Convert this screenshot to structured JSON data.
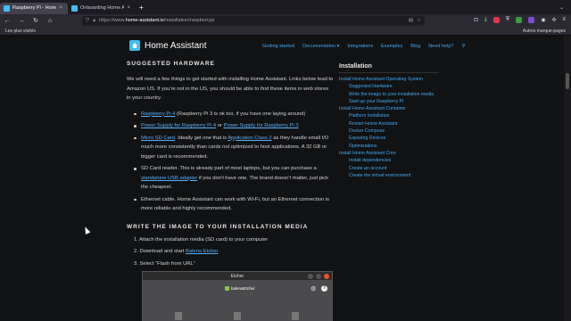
{
  "browser": {
    "tabs": [
      {
        "title": "Raspberry Pi - Home Assistant",
        "active": true
      },
      {
        "title": "Onboarding Home Assistant",
        "active": false
      }
    ],
    "url_prefix": "https://www.",
    "url_domain": "home-assistant.io",
    "url_path": "/installation/raspberrypi",
    "bookmarks": {
      "left": "Les plus visités",
      "right": "Autres marque-pages"
    }
  },
  "site": {
    "brand": "Home Assistant",
    "nav": [
      "Getting started",
      "Documentation ▾",
      "Integrations",
      "Examples",
      "Blog",
      "Need help?"
    ]
  },
  "main": {
    "hardware_heading": "SUGGESTED HARDWARE",
    "intro": "We will need a few things to get started with installing Home Assistant. Links below lead to Amazon US. If you’re not in the US, you should be able to find these items in web stores in your country.",
    "items": {
      "pi4_link": "Raspberry Pi 4",
      "pi4_rest": " (Raspberry Pi 3 is ok too, if you have one laying around)",
      "psu_link1": "Power Supply for Raspberry Pi 4",
      "psu_or": " or ",
      "psu_link2": "Power Supply for Raspberry Pi 3",
      "sd_link": "Micro SD Card",
      "sd_mid": ". Ideally get one that is ",
      "sd_link2": "Application Class 2",
      "sd_rest": " as they handle small I/O much more consistently than cards not optimized to host applications. A 32 GB or bigger card is recommended.",
      "reader_pre": "SD Card reader. This is already part of most laptops, but you can purchase a ",
      "reader_link": "standalone USB adapter",
      "reader_rest": " if you don’t have one. The brand doesn’t matter, just pick the cheapest.",
      "ethernet": "Ethernet cable. Home Assistant can work with Wi-Fi, but an Ethernet connection is more reliable and highly recommended."
    },
    "write_heading": "WRITE THE IMAGE TO YOUR INSTALLATION MEDIA",
    "steps": {
      "s1": "1. Attach the installation media (SD card) to your computer",
      "s2_pre": "2. Download and start ",
      "s2_link": "Balena Etcher",
      "s3": "3. Select “Flash from URL”"
    }
  },
  "sidebar": {
    "title": "Installation",
    "groups": [
      {
        "label": "Install Home Assistant Operating System",
        "children": [
          "Suggested Hardware",
          "Write the image to your installation media",
          "Start up your Raspberry Pi"
        ]
      },
      {
        "label": "Install Home Assistant Container",
        "children": [
          "Platform Installation",
          "Restart Home Assistant",
          "Docker Compose",
          "Exposing Devices",
          "Optimizations"
        ]
      },
      {
        "label": "Install Home Assistant Core",
        "children": [
          "Install dependencies",
          "Create an account",
          "Create the virtual environment"
        ]
      }
    ]
  },
  "etcher": {
    "window_title": "Etcher",
    "logo_text": "balenaEtcher"
  },
  "colors": {
    "accent": "#41bdf5",
    "link": "#5aaef8",
    "background": "#111214"
  }
}
